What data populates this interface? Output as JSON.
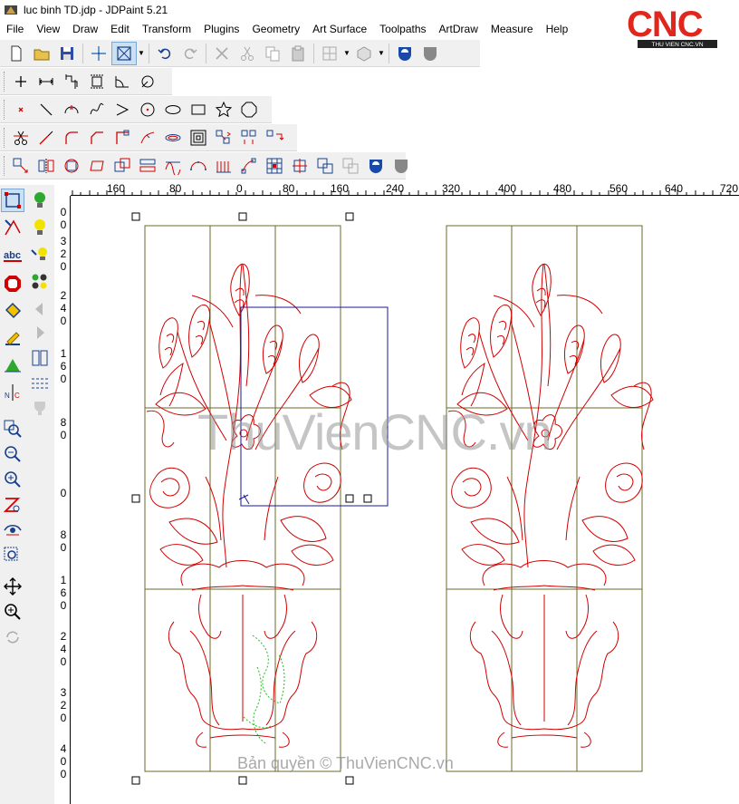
{
  "window": {
    "title": "luc binh TD.jdp - JDPaint 5.21"
  },
  "menu": [
    "File",
    "View",
    "Draw",
    "Edit",
    "Transform",
    "Plugins",
    "Geometry",
    "Art Surface",
    "Toolpaths",
    "ArtDraw",
    "Measure",
    "Help"
  ],
  "logo": {
    "text": "CNC",
    "subtitle": "THU VIEN CNC.VN"
  },
  "ruler": {
    "horizontal": [
      "160",
      "80",
      "0",
      "80",
      "160",
      "240",
      "320",
      "400",
      "480",
      "560",
      "640",
      "720"
    ],
    "vertical": [
      "0",
      "0",
      "",
      "3",
      "2",
      "0",
      "",
      "2",
      "4",
      "0",
      "",
      "1",
      "6",
      "0",
      "",
      "8",
      "0",
      "",
      "0",
      "",
      "8",
      "0",
      "",
      "1",
      "6",
      "0",
      "",
      "2",
      "4",
      "0",
      "",
      "3",
      "2",
      "0",
      "",
      "4",
      "0",
      "0"
    ]
  },
  "watermark": "ThuVienCNC.vn",
  "copyright": "Bản quyền © ThuVienCNC.vn",
  "colors": {
    "drawing": "#d10000",
    "grid": "#6b6b2a",
    "selection": "#1a1a9a",
    "highlight": "#22bb22",
    "logo_red": "#e0261d"
  }
}
